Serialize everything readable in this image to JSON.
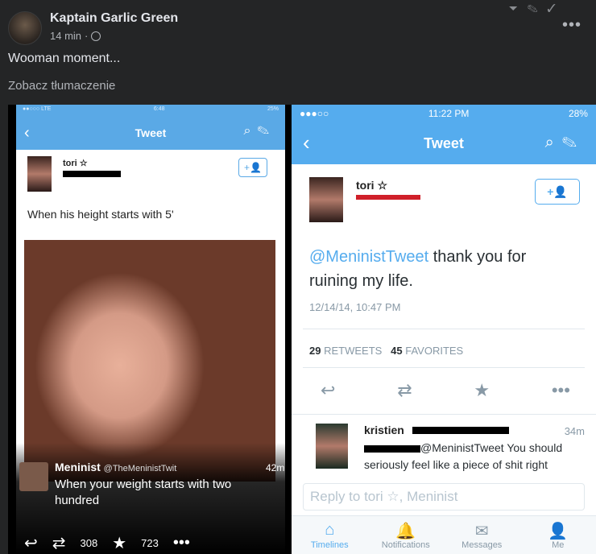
{
  "post": {
    "author": "Kaptain Garlic Green",
    "time": "14 min",
    "text": "Wooman moment...",
    "translate": "Zobacz tłumaczenie",
    "top_icons": "⏷ ✎ ✓",
    "more": "•••"
  },
  "left_phone": {
    "status_left": "●●○○○ LTE",
    "status_center": "6:48",
    "status_right": "25%",
    "nav_title": "Tweet",
    "user_name": "tori ☆",
    "follow_label": "+👤",
    "tweet_text": "When his height starts with 5'",
    "retweeter_name": "Meninist",
    "retweeter_handle": "@TheMeninistTwit",
    "retweet_time": "42m",
    "retweet_text": "When your weight starts with two hundred",
    "retweet_count": "308",
    "fav_count": "723"
  },
  "right_phone": {
    "status_left": "●●●○○",
    "status_time": "11:22 PM",
    "status_right": "28%",
    "nav_title": "Tweet",
    "user_name": "tori ☆",
    "follow_label": "+👤",
    "mention": "@MeninistTweet",
    "tweet_text": " thank you for ruining my life.",
    "date": "12/14/14, 10:47 PM",
    "retweets_num": "29",
    "retweets_label": " RETWEETS",
    "favorites_num": "45",
    "favorites_label": " FAVORITES",
    "reply_name": "kristien",
    "reply_time": "34m",
    "reply_text": "@MeninistTweet You should seriously feel like a piece of shit right",
    "reply_placeholder": "Reply to tori ☆, Meninist",
    "tabs": [
      "Timelines",
      "Notifications",
      "Messages",
      "Me"
    ]
  }
}
